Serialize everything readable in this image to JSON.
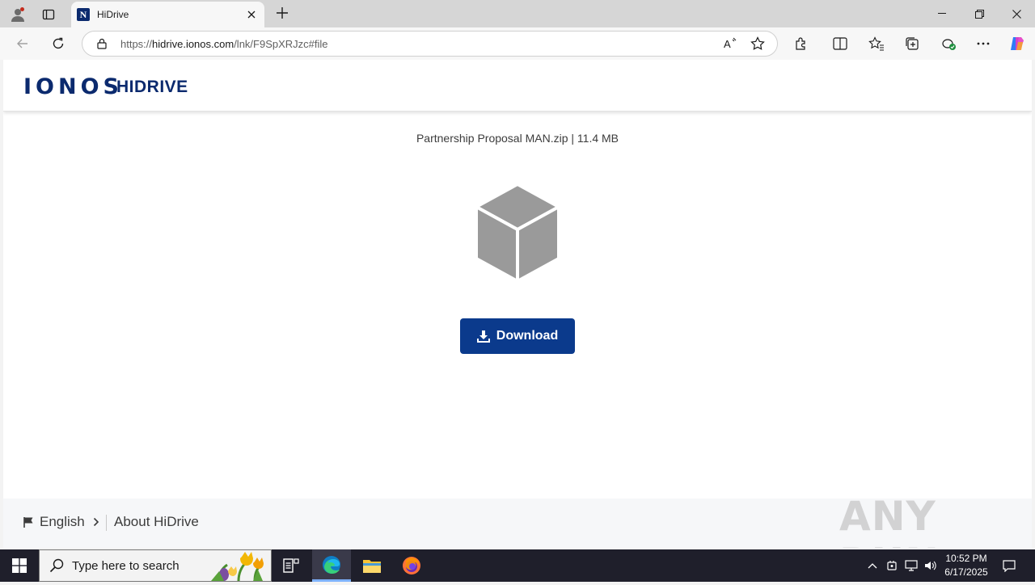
{
  "browser": {
    "tab_title": "HiDrive",
    "url_prefix": "https://",
    "url_host": "hidrive.ionos.com",
    "url_path": "/lnk/F9SpXRJzc#file",
    "read_aloud_icon_text": "A"
  },
  "site": {
    "logo_text": "IONOS",
    "product_text": "HIDRIVE",
    "file_info": "Partnership Proposal MAN.zip | 11.4 MB",
    "download_label": "Download",
    "footer": {
      "language": "English",
      "about": "About HiDrive"
    },
    "watermark": "ANY RUN"
  },
  "taskbar": {
    "search_placeholder": "Type here to search",
    "time": "10:52 PM",
    "date": "6/17/2025"
  },
  "colors": {
    "brand": "#0b2a6e",
    "button": "#0b3a8c",
    "cube": "#9a9a9a"
  }
}
